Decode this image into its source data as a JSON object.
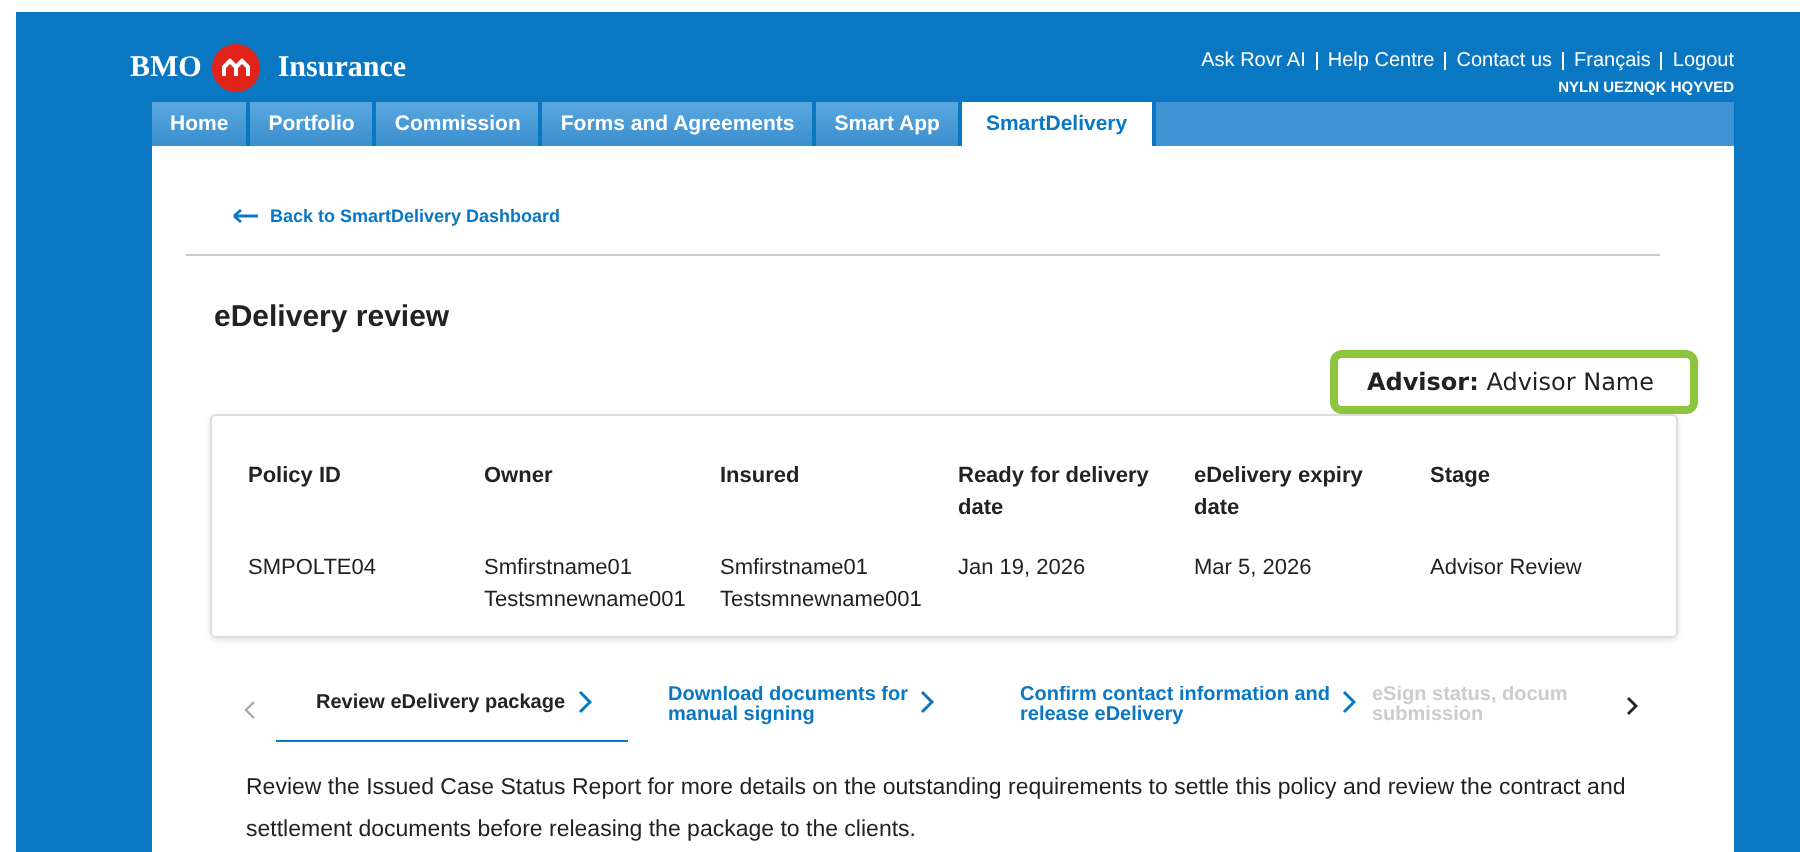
{
  "brand": {
    "name": "BMO",
    "product": "Insurance"
  },
  "top_links": [
    "Ask Rovr AI",
    "Help Centre",
    "Contact us",
    "Français",
    "Logout"
  ],
  "user_name": "NYLN UEZNQK HQYVED",
  "tabs": [
    {
      "label": "Home",
      "selected": false
    },
    {
      "label": "Portfolio",
      "selected": false
    },
    {
      "label": "Commission",
      "selected": false
    },
    {
      "label": "Forms and Agreements",
      "selected": false
    },
    {
      "label": "Smart App",
      "selected": false
    },
    {
      "label": "SmartDelivery",
      "selected": true
    }
  ],
  "back_link": "Back to SmartDelivery Dashboard",
  "title": "eDelivery review",
  "advisor": {
    "label": "Advisor:",
    "value": "Advisor Name"
  },
  "table": {
    "columns": [
      "Policy ID",
      "Owner",
      "Insured",
      "Ready for delivery date",
      "eDelivery expiry date",
      "Stage"
    ],
    "rows": [
      [
        "SMPOLTE04",
        "Smfirstname01 Testsmnewname001",
        "Smfirstname01 Testsmnewname001",
        "Jan 19, 2026",
        "Mar 5, 2026",
        "Advisor Review"
      ]
    ]
  },
  "steps": [
    {
      "lines": [
        "Review eDelivery package"
      ],
      "selected": true,
      "disabled": false
    },
    {
      "lines": [
        "Download documents for",
        "manual signing"
      ],
      "selected": false,
      "disabled": false
    },
    {
      "lines": [
        "Confirm contact information and",
        "release eDelivery"
      ],
      "selected": false,
      "disabled": false
    },
    {
      "lines": [
        "eSign status, docum",
        "submission"
      ],
      "selected": false,
      "disabled": true
    }
  ],
  "description": "Review the Issued Case Status Report for more details on the outstanding requirements to settle this policy and review the contract and settlement documents before releasing the package to the clients."
}
